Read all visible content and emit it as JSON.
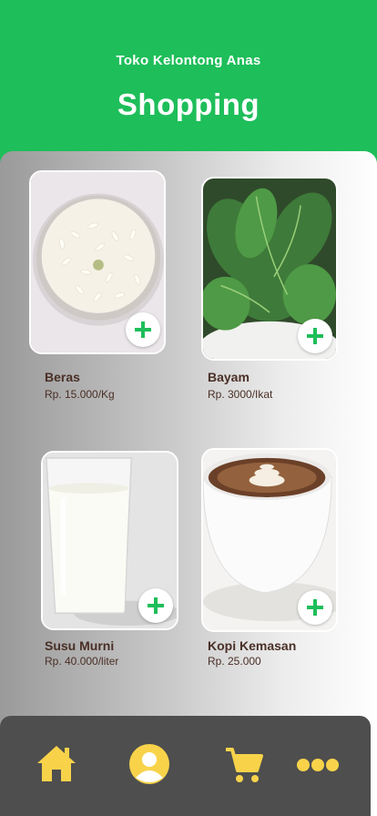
{
  "header": {
    "store_name": "Toko Kelontong Anas",
    "title": "Shopping"
  },
  "products": [
    {
      "name": "Beras",
      "price": "Rp. 15.000/Kg",
      "image": "rice-bowl"
    },
    {
      "name": "Bayam",
      "price": "Rp. 3000/Ikat",
      "image": "spinach"
    },
    {
      "name": "Susu Murni",
      "price": "Rp. 40.000/liter",
      "image": "milk-glass"
    },
    {
      "name": "Kopi Kemasan",
      "price": "Rp. 25.000",
      "image": "coffee-cup"
    }
  ],
  "nav": {
    "items": [
      {
        "icon": "home-icon"
      },
      {
        "icon": "profile-icon"
      },
      {
        "icon": "cart-icon"
      },
      {
        "icon": "more-icon"
      }
    ]
  },
  "colors": {
    "brand_green": "#1ebe5a",
    "accent_yellow": "#f8d34a",
    "nav_bg": "#4e4e4e",
    "text_brown": "#4a2f26"
  }
}
